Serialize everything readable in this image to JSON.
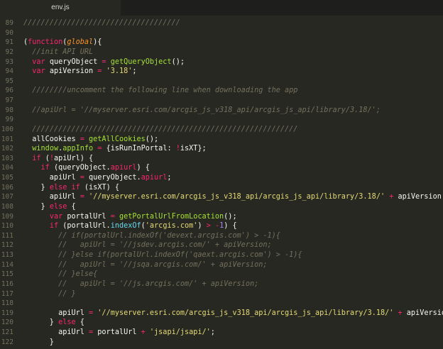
{
  "editor": {
    "tab_title": "env.js",
    "lines": [
      {
        "num": "89",
        "tokens": [
          {
            "c": "comment",
            "t": "////////////////////////////////////"
          }
        ]
      },
      {
        "num": "90",
        "tokens": []
      },
      {
        "num": "91",
        "tokens": [
          {
            "c": "plain",
            "t": "("
          },
          {
            "c": "kw",
            "t": "function"
          },
          {
            "c": "plain",
            "t": "("
          },
          {
            "c": "param",
            "t": "global"
          },
          {
            "c": "plain",
            "t": "){"
          }
        ]
      },
      {
        "num": "92",
        "tokens": [
          {
            "c": "plain",
            "t": "  "
          },
          {
            "c": "comment",
            "t": "//init API URL"
          }
        ]
      },
      {
        "num": "93",
        "tokens": [
          {
            "c": "plain",
            "t": "  "
          },
          {
            "c": "kw",
            "t": "var"
          },
          {
            "c": "plain",
            "t": " queryObject "
          },
          {
            "c": "kw",
            "t": "="
          },
          {
            "c": "plain",
            "t": " "
          },
          {
            "c": "fn",
            "t": "getQueryObject"
          },
          {
            "c": "plain",
            "t": "();"
          }
        ]
      },
      {
        "num": "94",
        "tokens": [
          {
            "c": "plain",
            "t": "  "
          },
          {
            "c": "kw",
            "t": "var"
          },
          {
            "c": "plain",
            "t": " apiVersion "
          },
          {
            "c": "kw",
            "t": "="
          },
          {
            "c": "plain",
            "t": " "
          },
          {
            "c": "str",
            "t": "'3.18'"
          },
          {
            "c": "plain",
            "t": ";"
          }
        ]
      },
      {
        "num": "95",
        "tokens": []
      },
      {
        "num": "96",
        "tokens": [
          {
            "c": "plain",
            "t": "  "
          },
          {
            "c": "comment",
            "t": "////////uncomment the following line when downloading the app"
          }
        ]
      },
      {
        "num": "97",
        "tokens": []
      },
      {
        "num": "98",
        "tokens": [
          {
            "c": "plain",
            "t": "  "
          },
          {
            "c": "comment",
            "t": "//apiUrl = '//myserver.esri.com/arcgis_js_v318_api/arcgis_js_api/library/3.18/';"
          }
        ]
      },
      {
        "num": "99",
        "tokens": []
      },
      {
        "num": "100",
        "tokens": [
          {
            "c": "plain",
            "t": "  "
          },
          {
            "c": "comment",
            "t": "/////////////////////////////////////////////////////////////"
          }
        ]
      },
      {
        "num": "101",
        "tokens": [
          {
            "c": "plain",
            "t": "  allCookies "
          },
          {
            "c": "kw",
            "t": "="
          },
          {
            "c": "plain",
            "t": " "
          },
          {
            "c": "fn",
            "t": "getAllCookies"
          },
          {
            "c": "plain",
            "t": "();"
          }
        ]
      },
      {
        "num": "102",
        "tokens": [
          {
            "c": "plain",
            "t": "  "
          },
          {
            "c": "fn",
            "t": "window"
          },
          {
            "c": "plain",
            "t": "."
          },
          {
            "c": "fn",
            "t": "appInfo"
          },
          {
            "c": "plain",
            "t": " "
          },
          {
            "c": "kw",
            "t": "="
          },
          {
            "c": "plain",
            "t": " {isRunInPortal: "
          },
          {
            "c": "kw",
            "t": "!"
          },
          {
            "c": "plain",
            "t": "isXT};"
          }
        ]
      },
      {
        "num": "103",
        "tokens": [
          {
            "c": "plain",
            "t": "  "
          },
          {
            "c": "kw",
            "t": "if"
          },
          {
            "c": "plain",
            "t": " ("
          },
          {
            "c": "kw",
            "t": "!"
          },
          {
            "c": "plain",
            "t": "apiUrl) {"
          }
        ]
      },
      {
        "num": "104",
        "tokens": [
          {
            "c": "plain",
            "t": "    "
          },
          {
            "c": "kw",
            "t": "if"
          },
          {
            "c": "plain",
            "t": " (queryObject."
          },
          {
            "c": "kw",
            "t": "apiurl"
          },
          {
            "c": "plain",
            "t": ") {"
          }
        ]
      },
      {
        "num": "105",
        "tokens": [
          {
            "c": "plain",
            "t": "      apiUrl "
          },
          {
            "c": "kw",
            "t": "="
          },
          {
            "c": "plain",
            "t": " queryObject."
          },
          {
            "c": "kw",
            "t": "apiurl"
          },
          {
            "c": "plain",
            "t": ";"
          }
        ]
      },
      {
        "num": "106",
        "tokens": [
          {
            "c": "plain",
            "t": "    } "
          },
          {
            "c": "kw",
            "t": "else"
          },
          {
            "c": "plain",
            "t": " "
          },
          {
            "c": "kw",
            "t": "if"
          },
          {
            "c": "plain",
            "t": " (isXT) {"
          }
        ]
      },
      {
        "num": "107",
        "tokens": [
          {
            "c": "plain",
            "t": "      apiUrl "
          },
          {
            "c": "kw",
            "t": "="
          },
          {
            "c": "plain",
            "t": " "
          },
          {
            "c": "str",
            "t": "'//myserver.esri.com/arcgis_js_v318_api/arcgis_js_api/library/3.18/'"
          },
          {
            "c": "plain",
            "t": " "
          },
          {
            "c": "kw",
            "t": "+"
          },
          {
            "c": "plain",
            "t": " apiVersion;"
          }
        ]
      },
      {
        "num": "108",
        "tokens": [
          {
            "c": "plain",
            "t": "    } "
          },
          {
            "c": "kw",
            "t": "else"
          },
          {
            "c": "plain",
            "t": " {"
          }
        ]
      },
      {
        "num": "109",
        "tokens": [
          {
            "c": "plain",
            "t": "      "
          },
          {
            "c": "kw",
            "t": "var"
          },
          {
            "c": "plain",
            "t": " portalUrl "
          },
          {
            "c": "kw",
            "t": "="
          },
          {
            "c": "plain",
            "t": " "
          },
          {
            "c": "fn",
            "t": "getPortalUrlFromLocation"
          },
          {
            "c": "plain",
            "t": "();"
          }
        ]
      },
      {
        "num": "110",
        "tokens": [
          {
            "c": "plain",
            "t": "      "
          },
          {
            "c": "kw",
            "t": "if"
          },
          {
            "c": "plain",
            "t": " (portalUrl."
          },
          {
            "c": "builtin",
            "t": "indexOf"
          },
          {
            "c": "plain",
            "t": "("
          },
          {
            "c": "str",
            "t": "'arcgis.com'"
          },
          {
            "c": "plain",
            "t": ") "
          },
          {
            "c": "kw",
            "t": ">"
          },
          {
            "c": "plain",
            "t": " "
          },
          {
            "c": "kw",
            "t": "-"
          },
          {
            "c": "num",
            "t": "1"
          },
          {
            "c": "plain",
            "t": ") {"
          }
        ]
      },
      {
        "num": "111",
        "tokens": [
          {
            "c": "plain",
            "t": "        "
          },
          {
            "c": "comment",
            "t": "// if(portalUrl.indexOf('devext.arcgis.com') > -1){"
          }
        ]
      },
      {
        "num": "112",
        "tokens": [
          {
            "c": "plain",
            "t": "        "
          },
          {
            "c": "comment",
            "t": "//   apiUrl = '//jsdev.arcgis.com/' + apiVersion;"
          }
        ]
      },
      {
        "num": "113",
        "tokens": [
          {
            "c": "plain",
            "t": "        "
          },
          {
            "c": "comment",
            "t": "// }else if(portalUrl.indexOf('qaext.arcgis.com') > -1){"
          }
        ]
      },
      {
        "num": "114",
        "tokens": [
          {
            "c": "plain",
            "t": "        "
          },
          {
            "c": "comment",
            "t": "//   apiUrl = '//jsqa.arcgis.com/' + apiVersion;"
          }
        ]
      },
      {
        "num": "115",
        "tokens": [
          {
            "c": "plain",
            "t": "        "
          },
          {
            "c": "comment",
            "t": "// }else{"
          }
        ]
      },
      {
        "num": "116",
        "tokens": [
          {
            "c": "plain",
            "t": "        "
          },
          {
            "c": "comment",
            "t": "//   apiUrl = '//js.arcgis.com/' + apiVersion;"
          }
        ]
      },
      {
        "num": "117",
        "tokens": [
          {
            "c": "plain",
            "t": "        "
          },
          {
            "c": "comment",
            "t": "// }"
          }
        ]
      },
      {
        "num": "118",
        "tokens": []
      },
      {
        "num": "119",
        "tokens": [
          {
            "c": "plain",
            "t": "        apiUrl "
          },
          {
            "c": "kw",
            "t": "="
          },
          {
            "c": "plain",
            "t": " "
          },
          {
            "c": "str",
            "t": "'//myserver.esri.com/arcgis_js_v318_api/arcgis_js_api/library/3.18/'"
          },
          {
            "c": "plain",
            "t": " "
          },
          {
            "c": "kw",
            "t": "+"
          },
          {
            "c": "plain",
            "t": " apiVersion;"
          }
        ]
      },
      {
        "num": "120",
        "tokens": [
          {
            "c": "plain",
            "t": "      } "
          },
          {
            "c": "kw",
            "t": "else"
          },
          {
            "c": "plain",
            "t": " {"
          }
        ]
      },
      {
        "num": "121",
        "tokens": [
          {
            "c": "plain",
            "t": "        apiUrl "
          },
          {
            "c": "kw",
            "t": "="
          },
          {
            "c": "plain",
            "t": " portalUrl "
          },
          {
            "c": "kw",
            "t": "+"
          },
          {
            "c": "plain",
            "t": " "
          },
          {
            "c": "str",
            "t": "'jsapi/jsapi/'"
          },
          {
            "c": "plain",
            "t": ";"
          }
        ]
      },
      {
        "num": "122",
        "tokens": [
          {
            "c": "plain",
            "t": "      }"
          }
        ]
      }
    ]
  }
}
